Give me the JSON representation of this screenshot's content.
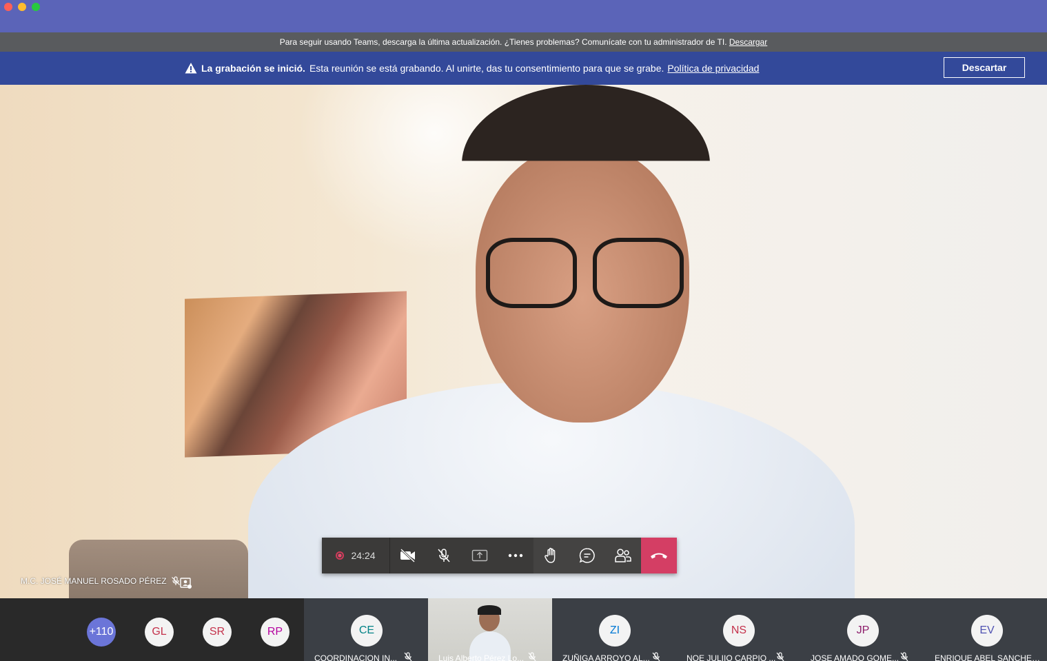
{
  "update_bar": {
    "message": "Para seguir usando Teams, descarga la última actualización. ¿Tienes problemas? Comunícate con tu administrador de TI.",
    "link": "Descargar"
  },
  "recording_banner": {
    "title": "La grabación se inició.",
    "message": "Esta reunión se está grabando. Al unirte, das tu consentimiento para que se grabe.",
    "link": "Política de privacidad",
    "dismiss": "Descartar"
  },
  "main_video": {
    "speaker_name": "M.C. JOSÉ MANUEL ROSADO PÉREZ"
  },
  "controls": {
    "timer": "24:24",
    "recording_color": "#e84a6d",
    "hangup_color": "#d43e64"
  },
  "participants": {
    "overflow": "+110",
    "small_avatars": [
      {
        "initials": "GL",
        "color": "#c4314b"
      },
      {
        "initials": "SR",
        "color": "#c4314b"
      },
      {
        "initials": "RP",
        "color": "#b4009e"
      }
    ],
    "tiles": [
      {
        "initials": "CE",
        "name": "COORDINACION IN...",
        "color": "#038387"
      },
      {
        "initials": "",
        "name": "Luis Alberto Pérez Lo...",
        "video": true
      },
      {
        "initials": "ZI",
        "name": "ZUÑIGA ARROYO AL...",
        "color": "#0078d4"
      },
      {
        "initials": "NS",
        "name": "NOE JULIIO CARPIO ...",
        "color": "#c4314b"
      },
      {
        "initials": "JP",
        "name": "JOSE AMADO GOME...",
        "color": "#8c1d6b"
      },
      {
        "initials": "EV",
        "name": "ENRIQUE ABEL SANCHEZ ...",
        "color": "#4f52b2"
      }
    ]
  }
}
